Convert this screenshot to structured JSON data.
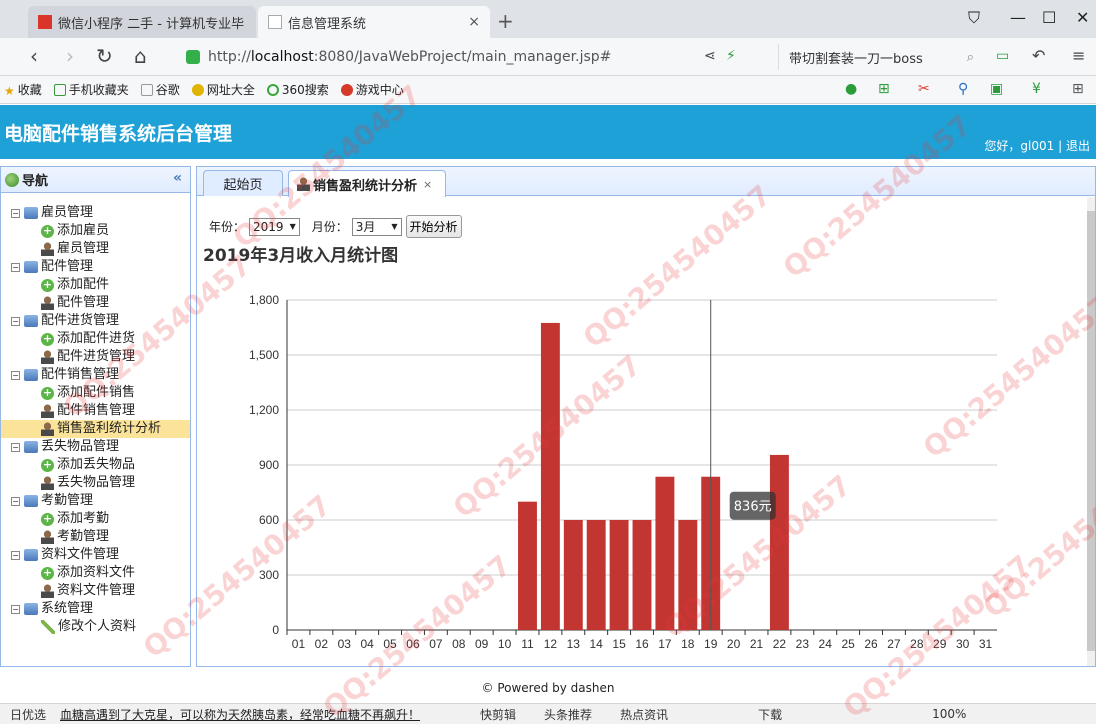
{
  "browser": {
    "tabs": [
      {
        "title": "微信小程序 二手 - 计算机专业毕"
      },
      {
        "title": "信息管理系统",
        "close": "×"
      }
    ],
    "new_tab": "+",
    "url_protocol": "http://",
    "url_host": "localhost",
    "url_rest": ":8080/JavaWebProject/main_manager.jsp#",
    "search_text": "带切割套装一刀一boss",
    "bookmarks": [
      "收藏",
      "手机收藏夹",
      "谷歌",
      "网址大全",
      "360搜索",
      "游戏中心"
    ]
  },
  "app": {
    "title": "电脑配件销售系统后台管理",
    "greeting": "您好，gl001",
    "separator": "|",
    "logout": "退出"
  },
  "sidebar": {
    "title": "导航",
    "collapse": "«",
    "groups": [
      {
        "label": "雇员管理",
        "items": [
          {
            "label": "添加雇员",
            "icon": "plus"
          },
          {
            "label": "雇员管理",
            "icon": "person"
          }
        ]
      },
      {
        "label": "配件管理",
        "items": [
          {
            "label": "添加配件",
            "icon": "plus"
          },
          {
            "label": "配件管理",
            "icon": "person"
          }
        ]
      },
      {
        "label": "配件进货管理",
        "items": [
          {
            "label": "添加配件进货",
            "icon": "plus"
          },
          {
            "label": "配件进货管理",
            "icon": "person"
          }
        ]
      },
      {
        "label": "配件销售管理",
        "items": [
          {
            "label": "添加配件销售",
            "icon": "plus"
          },
          {
            "label": "配件销售管理",
            "icon": "person"
          },
          {
            "label": "销售盈利统计分析",
            "icon": "person",
            "active": true
          }
        ]
      },
      {
        "label": "丢失物品管理",
        "items": [
          {
            "label": "添加丢失物品",
            "icon": "plus"
          },
          {
            "label": "丢失物品管理",
            "icon": "person"
          }
        ]
      },
      {
        "label": "考勤管理",
        "items": [
          {
            "label": "添加考勤",
            "icon": "plus"
          },
          {
            "label": "考勤管理",
            "icon": "person"
          }
        ]
      },
      {
        "label": "资料文件管理",
        "items": [
          {
            "label": "添加资料文件",
            "icon": "plus"
          },
          {
            "label": "资料文件管理",
            "icon": "person"
          }
        ]
      },
      {
        "label": "系统管理",
        "items": [
          {
            "label": "修改个人资料",
            "icon": "pencil"
          }
        ]
      }
    ]
  },
  "content": {
    "tabs": {
      "home": "起始页",
      "stats": "销售盈利统计分析",
      "close": "×"
    },
    "filters": {
      "year_label": "年份：",
      "year_value": "2019",
      "month_label": "月份：",
      "month_value": "3月",
      "run_button": "开始分析"
    },
    "chart_title": "2019年3月收入月统计图"
  },
  "chart_data": {
    "type": "bar",
    "title": "2019年3月收入月统计图",
    "categories": [
      "01",
      "02",
      "03",
      "04",
      "05",
      "06",
      "07",
      "08",
      "09",
      "10",
      "11",
      "12",
      "13",
      "14",
      "15",
      "16",
      "17",
      "18",
      "19",
      "20",
      "21",
      "22",
      "23",
      "24",
      "25",
      "26",
      "27",
      "28",
      "29",
      "30",
      "31"
    ],
    "values": [
      0,
      0,
      0,
      0,
      0,
      0,
      0,
      0,
      0,
      0,
      700,
      1675,
      600,
      600,
      600,
      600,
      836,
      600,
      836,
      0,
      0,
      955,
      0,
      0,
      0,
      0,
      0,
      0,
      0,
      0,
      0
    ],
    "ylim": [
      0,
      1800
    ],
    "yticks": [
      0,
      300,
      600,
      900,
      1200,
      1500,
      1800
    ],
    "ytick_labels": [
      "0",
      "300",
      "600",
      "900",
      "1,200",
      "1,500",
      "1,800"
    ],
    "bar_color": "#c23531",
    "grid": true,
    "tooltip": {
      "category": "19",
      "text": "836元"
    }
  },
  "footer": "© Powered by dashen",
  "statusbar": {
    "left": "日优选",
    "news": "血糖高遇到了大克星，可以称为天然胰岛素，经常吃血糖不再飙升！",
    "items": [
      "快剪辑",
      "头条推荐",
      "热点资讯",
      "下载",
      "100%"
    ]
  },
  "watermark": "QQ:254540457"
}
